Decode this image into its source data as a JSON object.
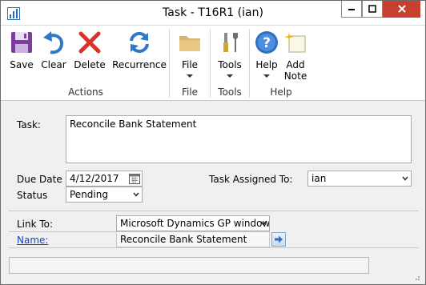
{
  "window": {
    "title": "Task  -  T16R1 (ian)"
  },
  "ribbon": {
    "groups": [
      {
        "name": "Actions",
        "buttons": [
          {
            "label": "Save",
            "icon": "save-icon"
          },
          {
            "label": "Clear",
            "icon": "undo-icon"
          },
          {
            "label": "Delete",
            "icon": "delete-x-icon"
          },
          {
            "label": "Recurrence",
            "icon": "recurrence-icon"
          }
        ]
      },
      {
        "name": "File",
        "buttons": [
          {
            "label": "File",
            "icon": "folder-icon"
          }
        ]
      },
      {
        "name": "Tools",
        "buttons": [
          {
            "label": "Tools",
            "icon": "tools-icon"
          }
        ]
      },
      {
        "name": "Help",
        "buttons": [
          {
            "label": "Help",
            "icon": "help-icon"
          },
          {
            "label": "Add",
            "label2": "Note",
            "icon": "add-note-icon"
          }
        ]
      }
    ]
  },
  "form": {
    "task_label": "Task:",
    "task_value": "Reconcile Bank Statement",
    "due_date_label": "Due Date",
    "due_date_value": "4/12/2017",
    "status_label": "Status",
    "status_value": "Pending",
    "assigned_label": "Task Assigned To:",
    "assigned_value": "ian",
    "link_to_label": "Link To:",
    "link_to_value": "Microsoft Dynamics GP window",
    "name_label": "Name:",
    "name_value": "Reconcile Bank Statement"
  },
  "colors": {
    "close_button": "#c7402f",
    "link": "#1a44c7"
  }
}
